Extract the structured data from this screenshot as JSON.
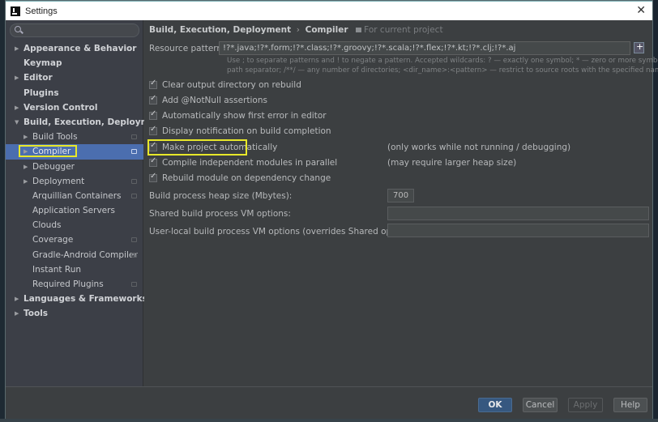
{
  "window": {
    "title": "Settings",
    "close_icon": "close-icon"
  },
  "search": {
    "placeholder": "",
    "value": ""
  },
  "sidebar": {
    "items": [
      {
        "label": "Appearance & Behavior",
        "level": 0,
        "arrow": "▶",
        "bold": true,
        "project": false,
        "selected": false
      },
      {
        "label": "Keymap",
        "level": 0,
        "arrow": "",
        "bold": true,
        "project": false,
        "selected": false
      },
      {
        "label": "Editor",
        "level": 0,
        "arrow": "▶",
        "bold": true,
        "project": false,
        "selected": false
      },
      {
        "label": "Plugins",
        "level": 0,
        "arrow": "",
        "bold": true,
        "project": false,
        "selected": false
      },
      {
        "label": "Version Control",
        "level": 0,
        "arrow": "▶",
        "bold": true,
        "project": false,
        "selected": false
      },
      {
        "label": "Build, Execution, Deployment",
        "level": 0,
        "arrow": "▼",
        "bold": true,
        "project": false,
        "selected": false
      },
      {
        "label": "Build Tools",
        "level": 1,
        "arrow": "▶",
        "bold": false,
        "project": true,
        "selected": false
      },
      {
        "label": "Compiler",
        "level": 1,
        "arrow": "▶",
        "bold": false,
        "project": true,
        "selected": true
      },
      {
        "label": "Debugger",
        "level": 1,
        "arrow": "▶",
        "bold": false,
        "project": false,
        "selected": false
      },
      {
        "label": "Deployment",
        "level": 1,
        "arrow": "▶",
        "bold": false,
        "project": true,
        "selected": false
      },
      {
        "label": "Arquillian Containers",
        "level": 1,
        "arrow": "",
        "bold": false,
        "project": true,
        "selected": false
      },
      {
        "label": "Application Servers",
        "level": 1,
        "arrow": "",
        "bold": false,
        "project": false,
        "selected": false
      },
      {
        "label": "Clouds",
        "level": 1,
        "arrow": "",
        "bold": false,
        "project": false,
        "selected": false
      },
      {
        "label": "Coverage",
        "level": 1,
        "arrow": "",
        "bold": false,
        "project": true,
        "selected": false
      },
      {
        "label": "Gradle-Android Compiler",
        "level": 1,
        "arrow": "",
        "bold": false,
        "project": true,
        "selected": false
      },
      {
        "label": "Instant Run",
        "level": 1,
        "arrow": "",
        "bold": false,
        "project": false,
        "selected": false
      },
      {
        "label": "Required Plugins",
        "level": 1,
        "arrow": "",
        "bold": false,
        "project": true,
        "selected": false
      },
      {
        "label": "Languages & Frameworks",
        "level": 0,
        "arrow": "▶",
        "bold": true,
        "project": false,
        "selected": false
      },
      {
        "label": "Tools",
        "level": 0,
        "arrow": "▶",
        "bold": true,
        "project": false,
        "selected": false
      }
    ]
  },
  "breadcrumb": {
    "parent": "Build, Execution, Deployment",
    "separator": "›",
    "current": "Compiler",
    "scope": "For current project"
  },
  "compiler": {
    "resource_patterns_label": "Resource patterns:",
    "resource_patterns_value": "!?*.java;!?*.form;!?*.class;!?*.groovy;!?*.scala;!?*.flex;!?*.kt;!?*.clj;!?*.aj",
    "hint_line1": "Use ; to separate patterns and ! to negate a pattern. Accepted wildcards: ? — exactly one symbol; * — zero or more symbols; / —",
    "hint_line2": "path separator; /**/ — any number of directories; <dir_name>:<pattern> — restrict to source roots with the specified name",
    "checkboxes": [
      {
        "label": "Clear output directory on rebuild",
        "checked": true,
        "note": ""
      },
      {
        "label": "Add @NotNull assertions",
        "checked": true,
        "note": ""
      },
      {
        "label": "Automatically show first error in editor",
        "checked": true,
        "note": ""
      },
      {
        "label": "Display notification on build completion",
        "checked": true,
        "note": ""
      },
      {
        "label": "Make project automatically",
        "checked": true,
        "note": "(only works while not running / debugging)"
      },
      {
        "label": "Compile independent modules in parallel",
        "checked": true,
        "note": "(may require larger heap size)"
      },
      {
        "label": "Rebuild module on dependency change",
        "checked": true,
        "note": ""
      }
    ],
    "heap_size_label": "Build process heap size (Mbytes):",
    "heap_size_value": "700",
    "shared_vm_label": "Shared build process VM options:",
    "shared_vm_value": "",
    "user_vm_label": "User-local build process VM options (overrides Shared options):",
    "user_vm_value": ""
  },
  "footer": {
    "ok": "OK",
    "cancel": "Cancel",
    "apply": "Apply",
    "help": "Help"
  },
  "colors": {
    "selection": "#4b6eaf",
    "highlight": "#e8e82a",
    "ok_button": "#365880"
  }
}
